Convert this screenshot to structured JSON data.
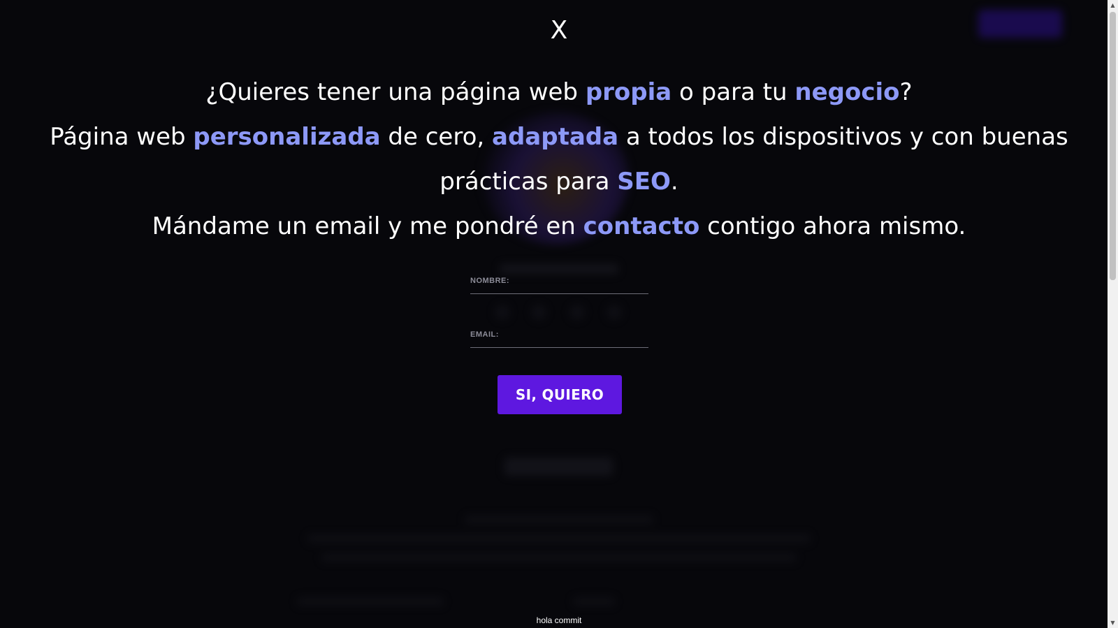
{
  "modal": {
    "close_label": "X",
    "line1": {
      "t1": "¿Quieres tener una página web ",
      "h1": "propia",
      "t2": " o para tu ",
      "h2": "negocio",
      "t3": "?"
    },
    "line2": {
      "t1": "Página web ",
      "h1": "personalizada",
      "t2": " de cero, ",
      "h2": "adaptada",
      "t3": " a todos los dispositivos y con buenas prácticas para ",
      "h3": "SEO",
      "t4": "."
    },
    "line3": {
      "t1": "Mándame un email y me pondré en ",
      "h1": "contacto",
      "t2": " contigo ahora mismo."
    },
    "form": {
      "name_label": "NOMBRE:",
      "name_value": "",
      "email_label": "EMAIL:",
      "email_value": "",
      "submit_label": "SI, QUIERO"
    }
  },
  "footer": {
    "note": "hola commit"
  },
  "colors": {
    "background": "#07070b",
    "highlight": "#8d99f7",
    "button": "#5e18e0",
    "text": "#ffffff"
  }
}
